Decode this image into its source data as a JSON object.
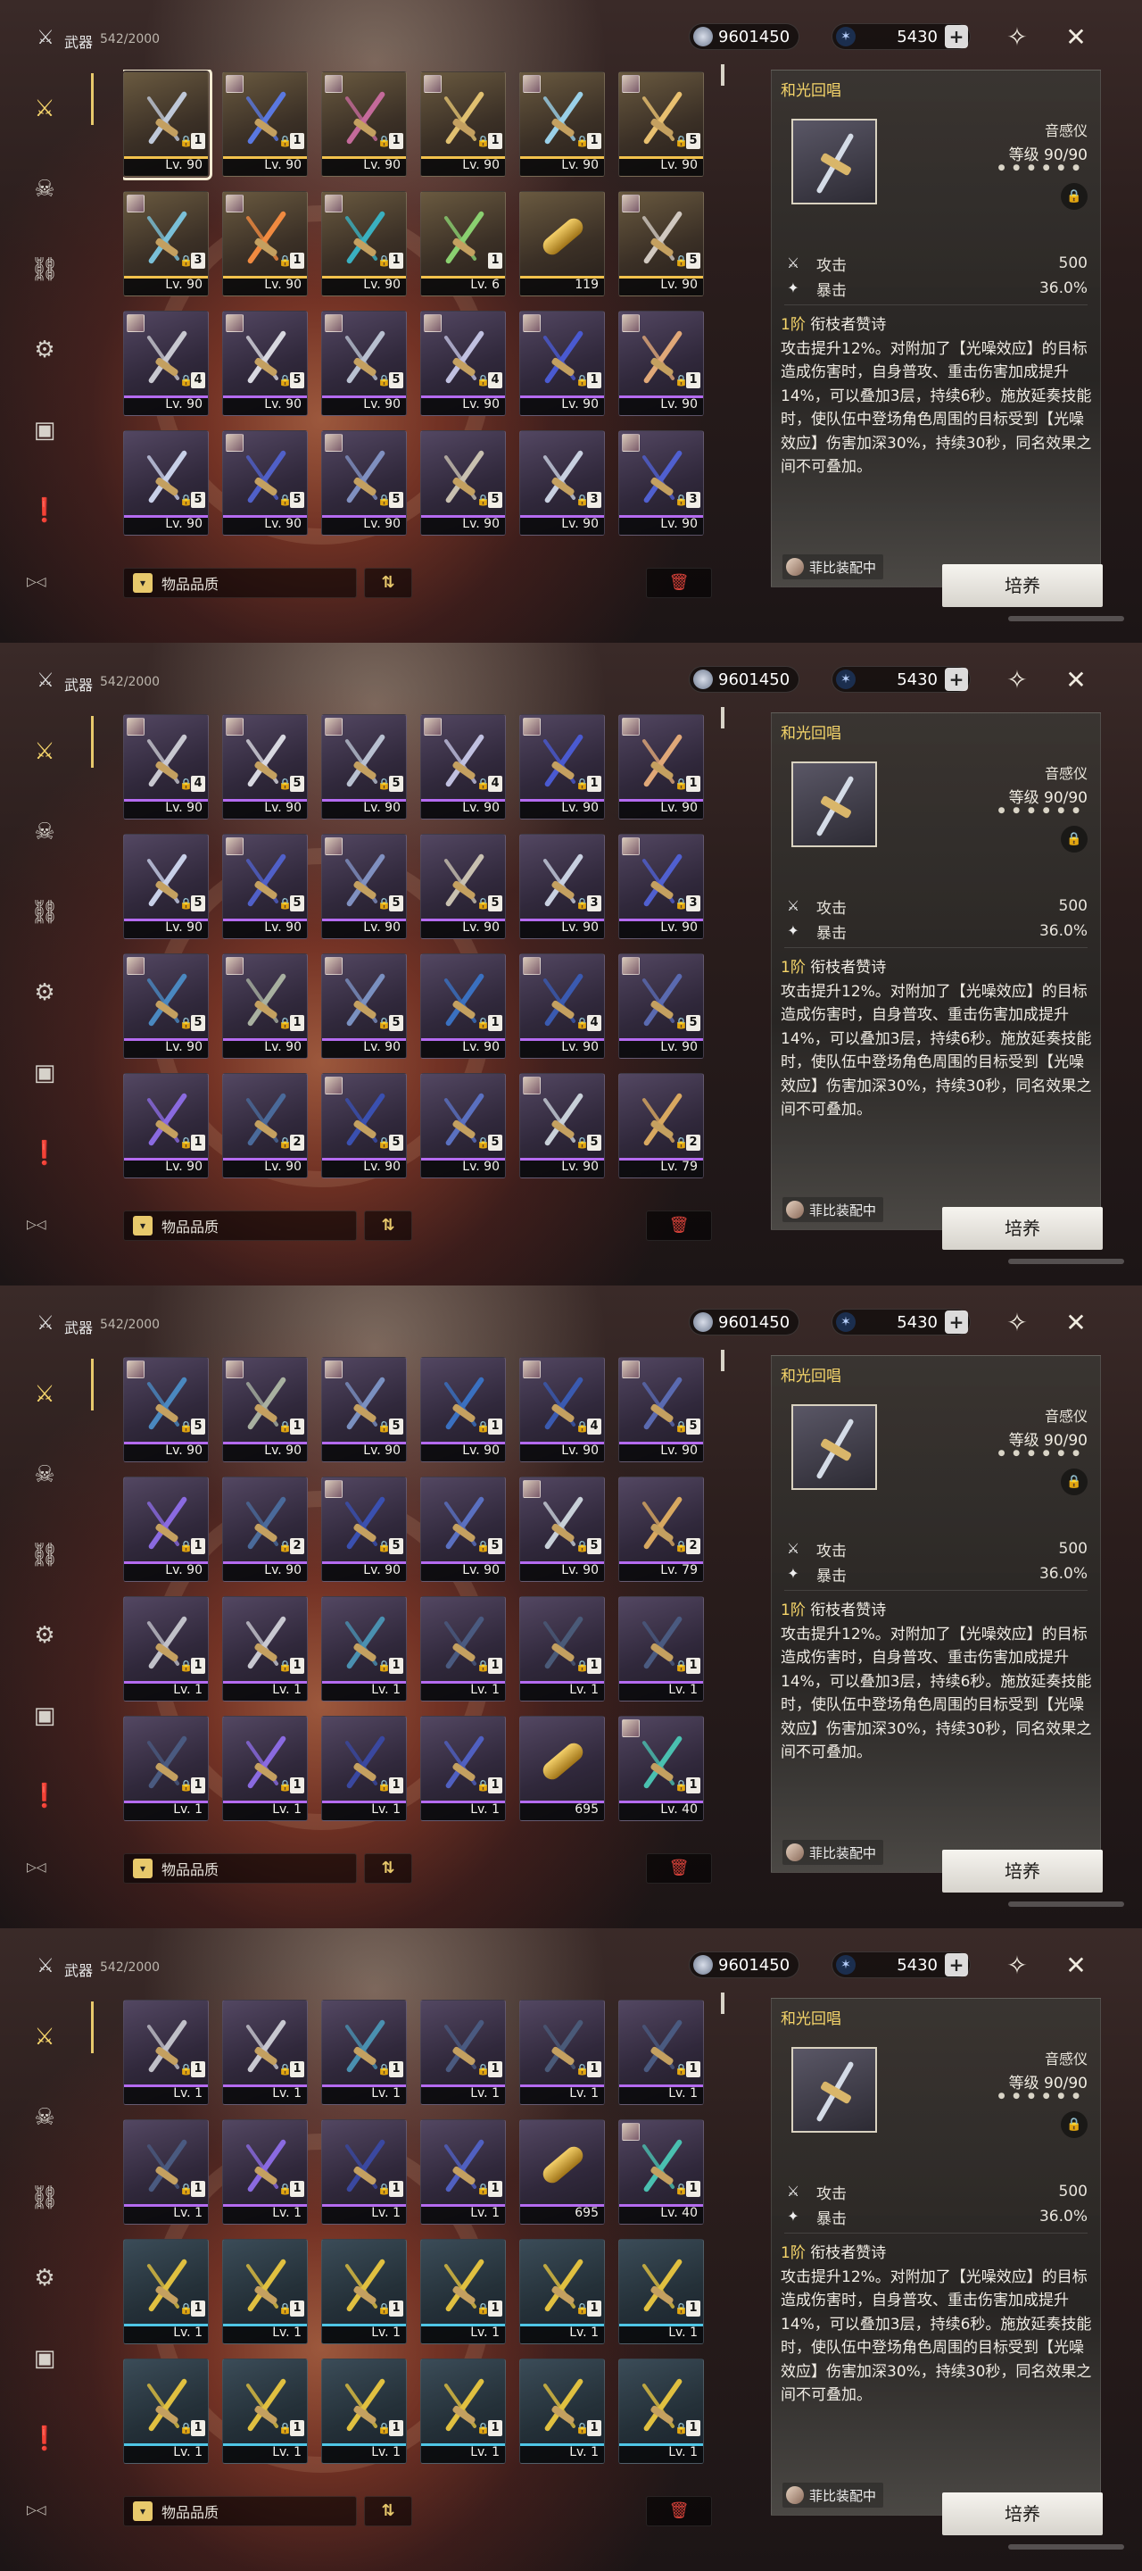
{
  "header": {
    "category": "武器",
    "count": "542/2000",
    "currency_coin": "9601450",
    "currency_star": "5430",
    "plus": "+"
  },
  "sidebar": {
    "items": [
      {
        "icon": "crossed-swords-icon",
        "active": true
      },
      {
        "icon": "demon-mask-icon",
        "active": false
      },
      {
        "icon": "chain-link-icon",
        "active": false
      },
      {
        "icon": "gear-disc-icon",
        "active": false
      },
      {
        "icon": "box-icon",
        "active": false
      },
      {
        "icon": "exclamation-doc-icon",
        "active": false
      }
    ],
    "collapse": "▷◁"
  },
  "bottom": {
    "sort_label": "物品品质",
    "sort_chevron": "▾",
    "order_icon": "⇅",
    "trash_icon": "🗑"
  },
  "detail": {
    "name": "和光回唱",
    "type": "音感仪",
    "level": "等级 90/90",
    "stars": "● ● ● ● ● ●",
    "lock_icon": "🔒",
    "stats": [
      {
        "name": "攻击",
        "value": "500",
        "icon": "sword-stat-icon"
      },
      {
        "name": "暴击",
        "value": "36.0%",
        "icon": "crit-stat-icon"
      }
    ],
    "passive_rank": "1阶",
    "passive_name": "衔枝者赞诗",
    "passive_text": "攻击提升12%。对附加了【光噪效应】的目标造成伤害时，自身普攻、重击伤害加成提升14%，可以叠加3层，持续6秒。施放延奏技能时，使队伍中登场角色周围的目标受到【光噪效应】伤害加深30%，持续30秒，同名效果之间不可叠加。",
    "equipped_by": "菲比装配中",
    "train_button": "培养"
  },
  "panels": [
    {
      "cards": [
        {
          "lv": "Lv. 90",
          "rank": "1",
          "q": 5,
          "lock": true,
          "sel": true,
          "avatar": false,
          "color": "#bfc8d8"
        },
        {
          "lv": "Lv. 90",
          "rank": "1",
          "q": 5,
          "lock": true,
          "avatar": true,
          "color": "#5a78e0"
        },
        {
          "lv": "Lv. 90",
          "rank": "1",
          "q": 5,
          "lock": true,
          "avatar": true,
          "color": "#c46a9a"
        },
        {
          "lv": "Lv. 90",
          "rank": "1",
          "q": 5,
          "lock": true,
          "avatar": true,
          "color": "#e0c070"
        },
        {
          "lv": "Lv. 90",
          "rank": "1",
          "q": 5,
          "lock": true,
          "avatar": true,
          "color": "#9ad0e8"
        },
        {
          "lv": "Lv. 90",
          "rank": "5",
          "q": 5,
          "lock": true,
          "avatar": true,
          "color": "#e8c070"
        },
        {
          "lv": "Lv. 90",
          "rank": "3",
          "q": 5,
          "lock": true,
          "avatar": true,
          "color": "#7ac0d8"
        },
        {
          "lv": "Lv. 90",
          "rank": "1",
          "q": 5,
          "lock": true,
          "avatar": true,
          "color": "#f08a40"
        },
        {
          "lv": "Lv. 90",
          "rank": "1",
          "q": 5,
          "lock": true,
          "avatar": true,
          "color": "#3ab0c0"
        },
        {
          "lv": "Lv. 6",
          "rank": "1",
          "q": 5,
          "lock": false,
          "avatar": false,
          "color": "#8ad070"
        },
        {
          "lv": "119",
          "rank": "",
          "q": 5,
          "lock": false,
          "avatar": false,
          "capsule": true,
          "color": "#e0b050"
        },
        {
          "lv": "Lv. 90",
          "rank": "5",
          "q": 5,
          "lock": true,
          "avatar": true,
          "color": "#d0c8c0"
        },
        {
          "lv": "Lv. 90",
          "rank": "4",
          "q": 4,
          "lock": true,
          "avatar": true,
          "color": "#c8c8d0"
        },
        {
          "lv": "Lv. 90",
          "rank": "5",
          "q": 4,
          "lock": true,
          "avatar": true,
          "color": "#d8d8e0"
        },
        {
          "lv": "Lv. 90",
          "rank": "5",
          "q": 4,
          "lock": true,
          "avatar": true,
          "color": "#b8c0d0"
        },
        {
          "lv": "Lv. 90",
          "rank": "4",
          "q": 4,
          "lock": true,
          "avatar": true,
          "color": "#c0c0e0"
        },
        {
          "lv": "Lv. 90",
          "rank": "1",
          "q": 4,
          "lock": true,
          "avatar": true,
          "color": "#4a5ad0"
        },
        {
          "lv": "Lv. 90",
          "rank": "1",
          "q": 4,
          "lock": true,
          "avatar": true,
          "color": "#e0a878"
        },
        {
          "lv": "Lv. 90",
          "rank": "5",
          "q": 4,
          "lock": true,
          "avatar": false,
          "color": "#c8d0e8"
        },
        {
          "lv": "Lv. 90",
          "rank": "5",
          "q": 4,
          "lock": true,
          "avatar": true,
          "color": "#5060c8"
        },
        {
          "lv": "Lv. 90",
          "rank": "5",
          "q": 4,
          "lock": true,
          "avatar": true,
          "color": "#8090c0"
        },
        {
          "lv": "Lv. 90",
          "rank": "5",
          "q": 4,
          "lock": true,
          "avatar": false,
          "color": "#c8c0b0"
        },
        {
          "lv": "Lv. 90",
          "rank": "3",
          "q": 4,
          "lock": true,
          "avatar": false,
          "color": "#c8d0e0"
        },
        {
          "lv": "Lv. 90",
          "rank": "3",
          "q": 4,
          "lock": true,
          "avatar": true,
          "color": "#5060d0"
        }
      ]
    },
    {
      "cards": [
        {
          "lv": "Lv. 90",
          "rank": "4",
          "q": 4,
          "lock": true,
          "avatar": true,
          "color": "#c8c8d0"
        },
        {
          "lv": "Lv. 90",
          "rank": "5",
          "q": 4,
          "lock": true,
          "avatar": true,
          "color": "#d8d8e0"
        },
        {
          "lv": "Lv. 90",
          "rank": "5",
          "q": 4,
          "lock": true,
          "avatar": true,
          "color": "#b8c0d0"
        },
        {
          "lv": "Lv. 90",
          "rank": "4",
          "q": 4,
          "lock": true,
          "avatar": true,
          "color": "#c0c0e0"
        },
        {
          "lv": "Lv. 90",
          "rank": "1",
          "q": 4,
          "lock": true,
          "avatar": true,
          "color": "#4a5ad0"
        },
        {
          "lv": "Lv. 90",
          "rank": "1",
          "q": 4,
          "lock": true,
          "avatar": true,
          "color": "#e0a878"
        },
        {
          "lv": "Lv. 90",
          "rank": "5",
          "q": 4,
          "lock": true,
          "avatar": false,
          "color": "#c8d0e8"
        },
        {
          "lv": "Lv. 90",
          "rank": "5",
          "q": 4,
          "lock": true,
          "avatar": true,
          "color": "#5060c8"
        },
        {
          "lv": "Lv. 90",
          "rank": "5",
          "q": 4,
          "lock": true,
          "avatar": true,
          "color": "#8090c0"
        },
        {
          "lv": "Lv. 90",
          "rank": "5",
          "q": 4,
          "lock": true,
          "avatar": false,
          "color": "#c8c0b0"
        },
        {
          "lv": "Lv. 90",
          "rank": "3",
          "q": 4,
          "lock": true,
          "avatar": false,
          "color": "#c8d0e0"
        },
        {
          "lv": "Lv. 90",
          "rank": "3",
          "q": 4,
          "lock": true,
          "avatar": true,
          "color": "#5060d0"
        },
        {
          "lv": "Lv. 90",
          "rank": "5",
          "q": 4,
          "lock": true,
          "avatar": true,
          "color": "#4a88c0"
        },
        {
          "lv": "Lv. 90",
          "rank": "1",
          "q": 4,
          "lock": true,
          "avatar": true,
          "color": "#a8b0a0"
        },
        {
          "lv": "Lv. 90",
          "rank": "5",
          "q": 4,
          "lock": true,
          "avatar": true,
          "color": "#7a90c0"
        },
        {
          "lv": "Lv. 90",
          "rank": "1",
          "q": 4,
          "lock": true,
          "avatar": false,
          "color": "#3a70c0"
        },
        {
          "lv": "Lv. 90",
          "rank": "4",
          "q": 4,
          "lock": true,
          "avatar": true,
          "color": "#3a5ab0"
        },
        {
          "lv": "Lv. 90",
          "rank": "5",
          "q": 4,
          "lock": true,
          "avatar": true,
          "color": "#5a6ab0"
        },
        {
          "lv": "Lv. 90",
          "rank": "1",
          "q": 4,
          "lock": true,
          "avatar": false,
          "color": "#8a6ae0"
        },
        {
          "lv": "Lv. 90",
          "rank": "2",
          "q": 4,
          "lock": true,
          "avatar": false,
          "color": "#4a6a9a"
        },
        {
          "lv": "Lv. 90",
          "rank": "5",
          "q": 4,
          "lock": true,
          "avatar": true,
          "color": "#3a50b0"
        },
        {
          "lv": "Lv. 90",
          "rank": "5",
          "q": 4,
          "lock": true,
          "avatar": false,
          "color": "#5a70c0"
        },
        {
          "lv": "Lv. 90",
          "rank": "5",
          "q": 4,
          "lock": true,
          "avatar": true,
          "color": "#c8d0d8"
        },
        {
          "lv": "Lv. 79",
          "rank": "2",
          "q": 4,
          "lock": true,
          "avatar": false,
          "color": "#d8a860"
        }
      ]
    },
    {
      "cards": [
        {
          "lv": "Lv. 90",
          "rank": "5",
          "q": 4,
          "lock": true,
          "avatar": true,
          "color": "#4a88c0"
        },
        {
          "lv": "Lv. 90",
          "rank": "1",
          "q": 4,
          "lock": true,
          "avatar": true,
          "color": "#a8b0a0"
        },
        {
          "lv": "Lv. 90",
          "rank": "5",
          "q": 4,
          "lock": true,
          "avatar": true,
          "color": "#7a90c0"
        },
        {
          "lv": "Lv. 90",
          "rank": "1",
          "q": 4,
          "lock": true,
          "avatar": false,
          "color": "#3a70c0"
        },
        {
          "lv": "Lv. 90",
          "rank": "4",
          "q": 4,
          "lock": true,
          "avatar": true,
          "color": "#3a5ab0"
        },
        {
          "lv": "Lv. 90",
          "rank": "5",
          "q": 4,
          "lock": true,
          "avatar": true,
          "color": "#5a6ab0"
        },
        {
          "lv": "Lv. 90",
          "rank": "1",
          "q": 4,
          "lock": true,
          "avatar": false,
          "color": "#8a6ae0"
        },
        {
          "lv": "Lv. 90",
          "rank": "2",
          "q": 4,
          "lock": true,
          "avatar": false,
          "color": "#4a6a9a"
        },
        {
          "lv": "Lv. 90",
          "rank": "5",
          "q": 4,
          "lock": true,
          "avatar": true,
          "color": "#3a50b0"
        },
        {
          "lv": "Lv. 90",
          "rank": "5",
          "q": 4,
          "lock": true,
          "avatar": false,
          "color": "#5a70c0"
        },
        {
          "lv": "Lv. 90",
          "rank": "5",
          "q": 4,
          "lock": true,
          "avatar": true,
          "color": "#c8d0d8"
        },
        {
          "lv": "Lv. 79",
          "rank": "2",
          "q": 4,
          "lock": true,
          "avatar": false,
          "color": "#d8a860"
        },
        {
          "lv": "Lv. 1",
          "rank": "1",
          "q": 4,
          "lock": true,
          "avatar": false,
          "color": "#c0c0c8"
        },
        {
          "lv": "Lv. 1",
          "rank": "1",
          "q": 4,
          "lock": true,
          "avatar": false,
          "color": "#c8c8d0"
        },
        {
          "lv": "Lv. 1",
          "rank": "1",
          "q": 4,
          "lock": true,
          "avatar": false,
          "color": "#4a90b0"
        },
        {
          "lv": "Lv. 1",
          "rank": "1",
          "q": 4,
          "lock": true,
          "avatar": false,
          "color": "#4a5a80"
        },
        {
          "lv": "Lv. 1",
          "rank": "1",
          "q": 4,
          "lock": true,
          "avatar": false,
          "color": "#4a5a78"
        },
        {
          "lv": "Lv. 1",
          "rank": "1",
          "q": 4,
          "lock": true,
          "avatar": false,
          "color": "#4a5a80"
        },
        {
          "lv": "Lv. 1",
          "rank": "1",
          "q": 4,
          "lock": true,
          "avatar": false,
          "color": "#4a5a80"
        },
        {
          "lv": "Lv. 1",
          "rank": "1",
          "q": 4,
          "lock": true,
          "avatar": false,
          "color": "#8a6ae0"
        },
        {
          "lv": "Lv. 1",
          "rank": "1",
          "q": 4,
          "lock": true,
          "avatar": false,
          "color": "#3a48a0"
        },
        {
          "lv": "Lv. 1",
          "rank": "1",
          "q": 4,
          "lock": true,
          "avatar": false,
          "color": "#5060c0"
        },
        {
          "lv": "695",
          "rank": "",
          "q": 4,
          "lock": false,
          "avatar": false,
          "capsule": true,
          "color": "#e0b050"
        },
        {
          "lv": "Lv. 40",
          "rank": "1",
          "q": 4,
          "lock": true,
          "avatar": true,
          "color": "#4ac0b0"
        }
      ]
    },
    {
      "cards": [
        {
          "lv": "Lv. 1",
          "rank": "1",
          "q": 4,
          "lock": true,
          "avatar": false,
          "color": "#c0c0c8"
        },
        {
          "lv": "Lv. 1",
          "rank": "1",
          "q": 4,
          "lock": true,
          "avatar": false,
          "color": "#c8c8d0"
        },
        {
          "lv": "Lv. 1",
          "rank": "1",
          "q": 4,
          "lock": true,
          "avatar": false,
          "color": "#4a90b0"
        },
        {
          "lv": "Lv. 1",
          "rank": "1",
          "q": 4,
          "lock": true,
          "avatar": false,
          "color": "#4a5a80"
        },
        {
          "lv": "Lv. 1",
          "rank": "1",
          "q": 4,
          "lock": true,
          "avatar": false,
          "color": "#4a5a78"
        },
        {
          "lv": "Lv. 1",
          "rank": "1",
          "q": 4,
          "lock": true,
          "avatar": false,
          "color": "#4a5a80"
        },
        {
          "lv": "Lv. 1",
          "rank": "1",
          "q": 4,
          "lock": true,
          "avatar": false,
          "color": "#4a5a80"
        },
        {
          "lv": "Lv. 1",
          "rank": "1",
          "q": 4,
          "lock": true,
          "avatar": false,
          "color": "#8a6ae0"
        },
        {
          "lv": "Lv. 1",
          "rank": "1",
          "q": 4,
          "lock": true,
          "avatar": false,
          "color": "#3a48a0"
        },
        {
          "lv": "Lv. 1",
          "rank": "1",
          "q": 4,
          "lock": true,
          "avatar": false,
          "color": "#5060c0"
        },
        {
          "lv": "695",
          "rank": "",
          "q": 4,
          "lock": false,
          "avatar": false,
          "capsule": true,
          "color": "#e0b050"
        },
        {
          "lv": "Lv. 40",
          "rank": "1",
          "q": 4,
          "lock": true,
          "avatar": true,
          "color": "#4ac0b0"
        },
        {
          "lv": "Lv. 1",
          "rank": "1",
          "q": 3,
          "lock": true,
          "avatar": false,
          "color": "#e0c040"
        },
        {
          "lv": "Lv. 1",
          "rank": "1",
          "q": 3,
          "lock": true,
          "avatar": false,
          "color": "#e0c040"
        },
        {
          "lv": "Lv. 1",
          "rank": "1",
          "q": 3,
          "lock": true,
          "avatar": false,
          "color": "#e0c040"
        },
        {
          "lv": "Lv. 1",
          "rank": "1",
          "q": 3,
          "lock": true,
          "avatar": false,
          "color": "#e0c040"
        },
        {
          "lv": "Lv. 1",
          "rank": "1",
          "q": 3,
          "lock": true,
          "avatar": false,
          "color": "#e0c040"
        },
        {
          "lv": "Lv. 1",
          "rank": "1",
          "q": 3,
          "lock": true,
          "avatar": false,
          "color": "#e0c040"
        },
        {
          "lv": "Lv. 1",
          "rank": "1",
          "q": 3,
          "lock": true,
          "avatar": false,
          "color": "#e0c040"
        },
        {
          "lv": "Lv. 1",
          "rank": "1",
          "q": 3,
          "lock": true,
          "avatar": false,
          "color": "#e0c040"
        },
        {
          "lv": "Lv. 1",
          "rank": "1",
          "q": 3,
          "lock": true,
          "avatar": false,
          "color": "#e0c040"
        },
        {
          "lv": "Lv. 1",
          "rank": "1",
          "q": 3,
          "lock": true,
          "avatar": false,
          "color": "#e0c040"
        },
        {
          "lv": "Lv. 1",
          "rank": "1",
          "q": 3,
          "lock": true,
          "avatar": false,
          "color": "#e0c040"
        },
        {
          "lv": "Lv. 1",
          "rank": "1",
          "q": 3,
          "lock": true,
          "avatar": false,
          "color": "#e0c040"
        }
      ]
    }
  ]
}
